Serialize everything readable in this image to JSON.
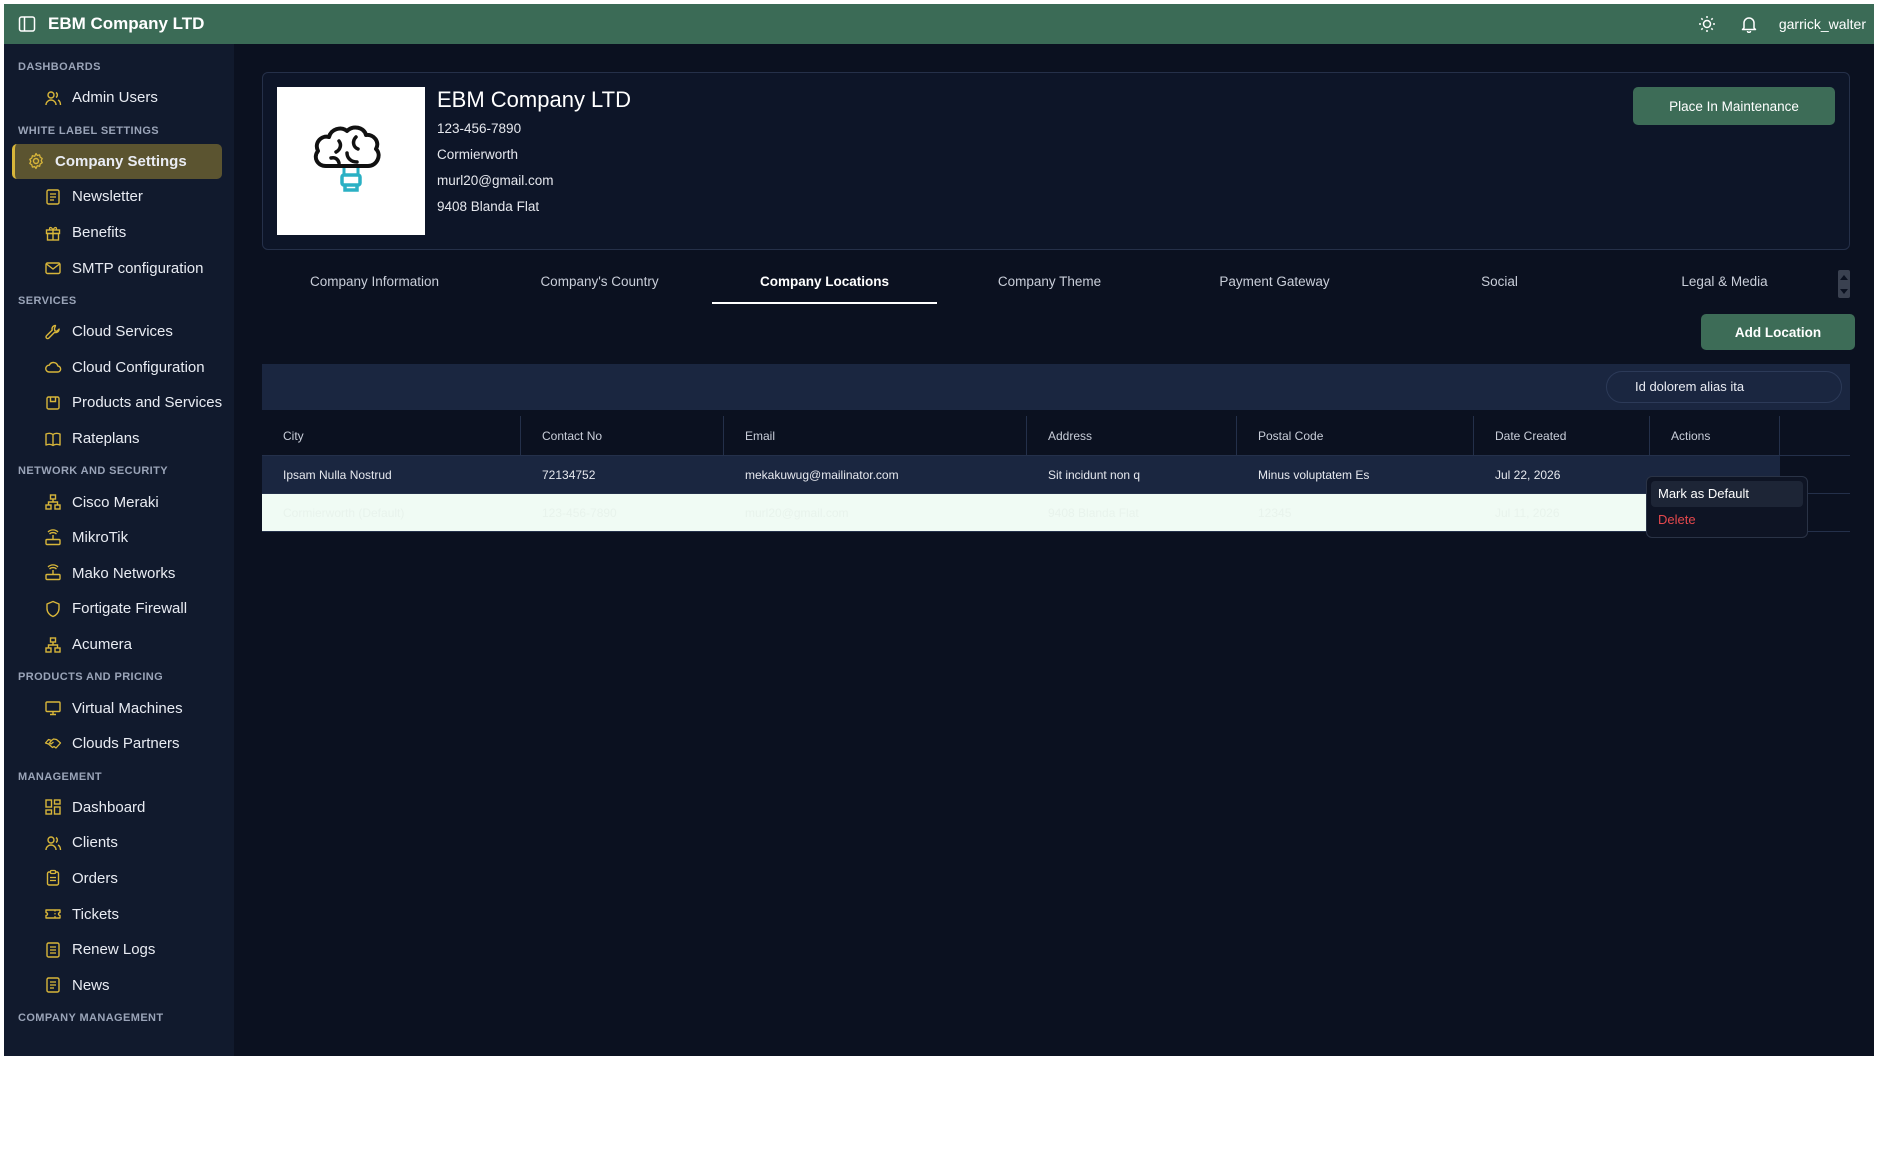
{
  "topbar": {
    "title": "EBM Company LTD",
    "username": "garrick_walter"
  },
  "sidebar": {
    "sections": [
      {
        "title": "DASHBOARDS",
        "items": [
          {
            "label": "Admin Users",
            "icon": "users-icon"
          }
        ]
      },
      {
        "title": "WHITE LABEL SETTINGS",
        "items": [
          {
            "label": "Company Settings",
            "icon": "gear-icon",
            "active": true
          },
          {
            "label": "Newsletter",
            "icon": "newspaper-icon"
          },
          {
            "label": "Benefits",
            "icon": "gift-icon"
          },
          {
            "label": "SMTP configuration",
            "icon": "mail-icon"
          }
        ]
      },
      {
        "title": "SERVICES",
        "items": [
          {
            "label": "Cloud Services",
            "icon": "wrench-icon"
          },
          {
            "label": "Cloud Configuration",
            "icon": "cloud-icon"
          },
          {
            "label": "Products and Services",
            "icon": "package-icon"
          },
          {
            "label": "Rateplans",
            "icon": "book-icon"
          }
        ]
      },
      {
        "title": "NETWORK AND SECURITY",
        "items": [
          {
            "label": "Cisco Meraki",
            "icon": "network-icon"
          },
          {
            "label": "MikroTik",
            "icon": "router-icon"
          },
          {
            "label": "Mako Networks",
            "icon": "router-icon"
          },
          {
            "label": "Fortigate Firewall",
            "icon": "shield-icon"
          },
          {
            "label": "Acumera",
            "icon": "network-icon"
          }
        ]
      },
      {
        "title": "PRODUCTS AND PRICING",
        "items": [
          {
            "label": "Virtual Machines",
            "icon": "monitor-icon"
          },
          {
            "label": "Clouds Partners",
            "icon": "handshake-icon"
          }
        ]
      },
      {
        "title": "MANAGEMENT",
        "items": [
          {
            "label": "Dashboard",
            "icon": "grid-icon"
          },
          {
            "label": "Clients",
            "icon": "users-icon"
          },
          {
            "label": "Orders",
            "icon": "clipboard-icon"
          },
          {
            "label": "Tickets",
            "icon": "ticket-icon"
          },
          {
            "label": "Renew Logs",
            "icon": "list-icon"
          },
          {
            "label": "News",
            "icon": "newspaper-icon"
          }
        ]
      },
      {
        "title": "COMPANY MANAGEMENT",
        "items": []
      }
    ]
  },
  "company": {
    "name": "EBM Company LTD",
    "phone": "123-456-7890",
    "city": "Cormierworth",
    "email": "murl20@gmail.com",
    "address": "9408 Blanda Flat",
    "maintenance_label": "Place In Maintenance"
  },
  "tabs": [
    "Company Information",
    "Company's Country",
    "Company Locations",
    "Company Theme",
    "Payment Gateway",
    "Social",
    "Legal & Media"
  ],
  "active_tab": "Company Locations",
  "add_location_label": "Add Location",
  "filter": {
    "value": "Id dolorem alias ita"
  },
  "table": {
    "columns": [
      "City",
      "Contact No",
      "Email",
      "Address",
      "Postal Code",
      "Date Created",
      "Actions"
    ],
    "rows": [
      {
        "city": "Ipsam Nulla Nostrud",
        "contact": "72134752",
        "email": "mekakuwug@mailinator.com",
        "address": "Sit incidunt non q",
        "postal": "Minus voluptatem Es",
        "date": "Jul 22, 2026"
      },
      {
        "city": "Cormierworth (Default)",
        "contact": "123-456-7890",
        "email": "murl20@gmail.com",
        "address": "9408 Blanda Flat",
        "postal": "12345",
        "date": "Jul 11, 2026"
      }
    ]
  },
  "context_menu": {
    "items": [
      "Mark as Default",
      "Delete"
    ]
  },
  "colors": {
    "topbar": "#3b6b56",
    "accent_button": "#3d6c57",
    "active_nav": "#5b5430",
    "danger": "#e5484d",
    "background": "#0b1120"
  }
}
